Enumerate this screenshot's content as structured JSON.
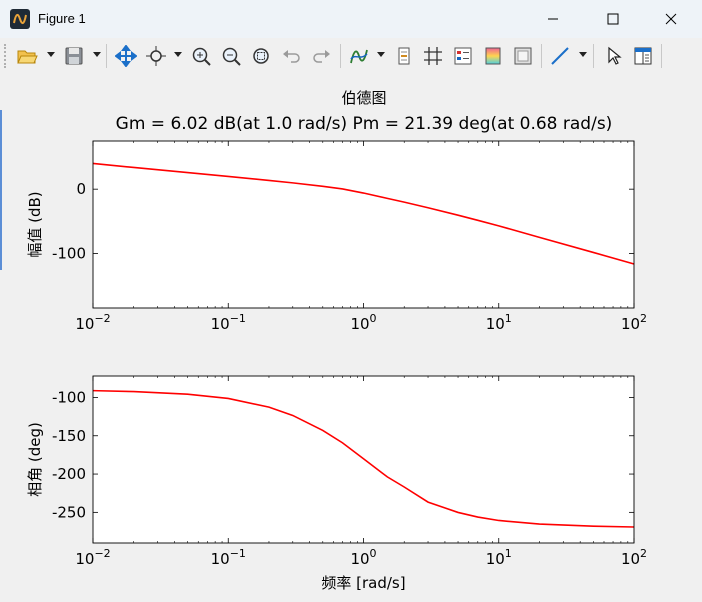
{
  "window": {
    "title": "Figure 1"
  },
  "toolbar": {
    "buttons": [
      "open-file",
      "save",
      "pan",
      "data-cursor",
      "zoom-in",
      "zoom-out",
      "reset-view",
      "undo",
      "redo",
      "insert-function",
      "insert-colorbar",
      "grid",
      "insert-legend",
      "colormap",
      "axes-box",
      "line-style",
      "edit-plot",
      "property-editor"
    ]
  },
  "colors": {
    "line": "#ff0000",
    "background": "#f0f0f0",
    "axes_bg": "#ffffff"
  },
  "chart_data": [
    {
      "type": "line",
      "title": "伯德图",
      "subtitle": "Gm = 6.02 dB(at 1.0 rad/s) Pm = 21.39 deg(at 0.68 rad/s)",
      "xlabel": "",
      "ylabel": "幅值 (dB)",
      "xscale": "log",
      "xlim": [
        0.01,
        100
      ],
      "ylim": [
        -185,
        75
      ],
      "xticks": [
        0.01,
        0.1,
        1,
        10,
        100
      ],
      "xticklabels": [
        [
          "10",
          "−2"
        ],
        [
          "10",
          "−1"
        ],
        [
          "10",
          "0"
        ],
        [
          "10",
          "1"
        ],
        [
          "10",
          "2"
        ]
      ],
      "yticks": [
        0,
        -100
      ],
      "yticklabels": [
        "0",
        "-100"
      ],
      "grid": false,
      "series": [
        {
          "x": [
            0.01,
            0.02,
            0.05,
            0.1,
            0.2,
            0.3,
            0.5,
            0.7,
            1,
            1.5,
            2,
            3,
            5,
            7,
            10,
            20,
            50,
            100
          ],
          "y": [
            40,
            33.8,
            25.8,
            19.8,
            13.6,
            9.8,
            4.4,
            0.4,
            -6,
            -14.3,
            -20.2,
            -28.9,
            -40.5,
            -48.5,
            -57.1,
            -75.1,
            -98.5,
            -116.5
          ]
        }
      ]
    },
    {
      "type": "line",
      "title": "",
      "xlabel": "频率 [rad/s]",
      "ylabel": "相角 (deg)",
      "xscale": "log",
      "xlim": [
        0.01,
        100
      ],
      "ylim": [
        -290,
        -72
      ],
      "xticks": [
        0.01,
        0.1,
        1,
        10,
        100
      ],
      "xticklabels": [
        [
          "10",
          "−2"
        ],
        [
          "10",
          "−1"
        ],
        [
          "10",
          "0"
        ],
        [
          "10",
          "1"
        ],
        [
          "10",
          "2"
        ]
      ],
      "yticks": [
        -100,
        -150,
        -200,
        -250
      ],
      "yticklabels": [
        "-100",
        "-150",
        "-200",
        "-250"
      ],
      "grid": false,
      "series": [
        {
          "x": [
            0.01,
            0.02,
            0.05,
            0.1,
            0.2,
            0.3,
            0.5,
            0.7,
            1,
            1.5,
            2,
            3,
            5,
            7,
            10,
            20,
            50,
            100
          ],
          "y": [
            -91.1,
            -92.3,
            -95.7,
            -101.3,
            -112.6,
            -123.5,
            -143.1,
            -159.3,
            -180,
            -203.7,
            -216.9,
            -236.6,
            -250.1,
            -256.1,
            -260.6,
            -265.3,
            -268.1,
            -269.1
          ]
        }
      ]
    }
  ]
}
